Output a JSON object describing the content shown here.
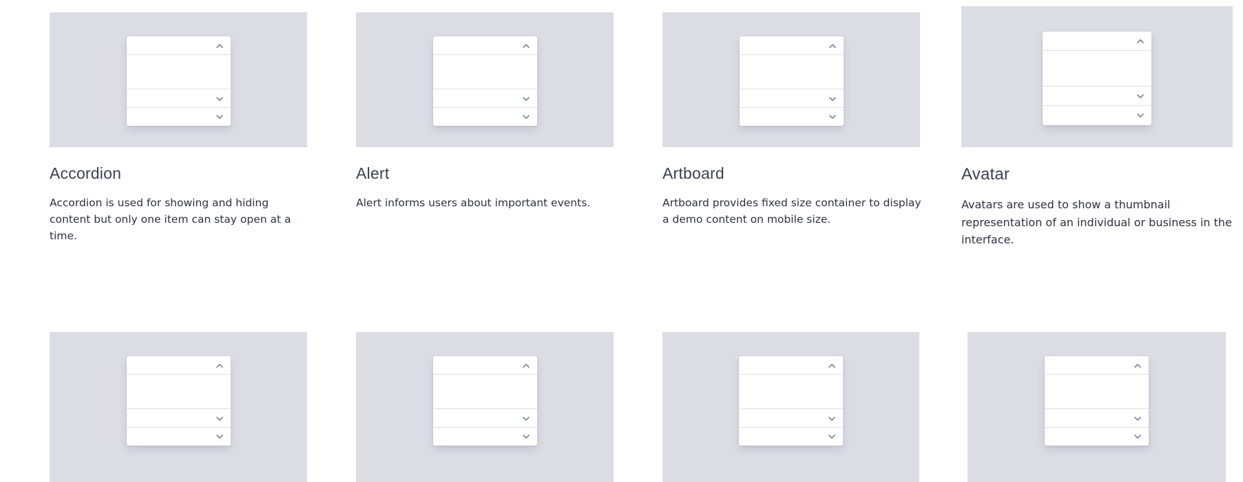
{
  "cards": [
    {
      "title": "Accordion",
      "description": "Accordion is used for showing and hiding content but only one item can stay open at a time.",
      "preview_icons": [
        "chevron-up-icon",
        "chevron-down-icon",
        "chevron-down-icon"
      ]
    },
    {
      "title": "Alert",
      "description": "Alert informs users about important events.",
      "preview_icons": [
        "chevron-up-icon",
        "chevron-down-icon",
        "chevron-down-icon"
      ]
    },
    {
      "title": "Artboard",
      "description": "Artboard provides fixed size container to display a demo content on mobile size.",
      "preview_icons": [
        "chevron-up-icon",
        "chevron-down-icon",
        "chevron-down-icon"
      ]
    },
    {
      "title": "Avatar",
      "description": "Avatars are used to show a thumbnail representation of an individual or business in the interface.",
      "preview_icons": [
        "chevron-up-icon",
        "chevron-down-icon",
        "chevron-down-icon"
      ]
    },
    {
      "title": "",
      "description": "",
      "preview_icons": [
        "chevron-up-icon",
        "chevron-down-icon",
        "chevron-down-icon"
      ]
    },
    {
      "title": "",
      "description": "",
      "preview_icons": [
        "chevron-up-icon",
        "chevron-down-icon",
        "chevron-down-icon"
      ]
    },
    {
      "title": "",
      "description": "",
      "preview_icons": [
        "chevron-up-icon",
        "chevron-down-icon",
        "chevron-down-icon"
      ]
    },
    {
      "title": "",
      "description": "",
      "preview_icons": [
        "chevron-up-icon",
        "chevron-down-icon",
        "chevron-down-icon"
      ]
    }
  ],
  "colors": {
    "preview_background": "#dcdde4",
    "panel": "#ffffff",
    "divider": "#dddfe6",
    "chevron": "#7c8396",
    "title": "#3a4150",
    "text": "#2c3140"
  }
}
